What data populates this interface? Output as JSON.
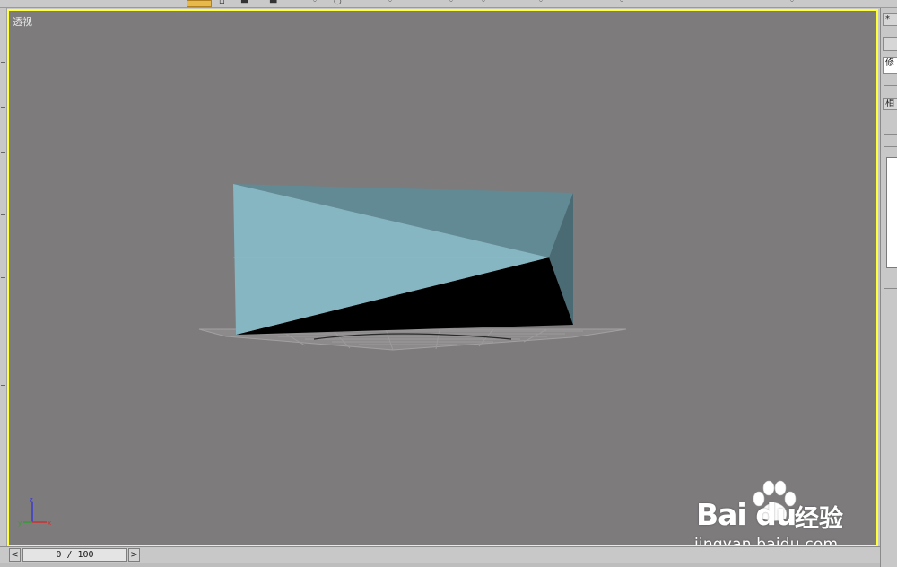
{
  "viewport": {
    "label": "透视",
    "border_color": "#ffff3a",
    "background": "#7d7b7c",
    "object": {
      "type": "box",
      "colors": {
        "front_face": "#85b6c2",
        "top_face": "#618a95",
        "side_face": "#4a6a74",
        "shadow_face": "#000000"
      }
    },
    "grid_visible": true,
    "axis_gizmo": {
      "x": "x",
      "y": "y",
      "z": "z"
    }
  },
  "time_slider": {
    "current_frame": "0",
    "total_frames": "100",
    "display": "0 / 100",
    "prev_label": "<",
    "next_label": ">"
  },
  "right_panel": {
    "tab_1": "*",
    "tab_2": "修",
    "tab_3": "相"
  },
  "watermark": {
    "brand": "Bai du",
    "product": "经验",
    "url": "jingyan.baidu.com"
  },
  "icons": [
    "axis-gizmo-icon",
    "baidu-paw-icon",
    "prev-frame-icon",
    "next-frame-icon"
  ],
  "toolbar": {
    "active_color": "#e7b84b"
  }
}
